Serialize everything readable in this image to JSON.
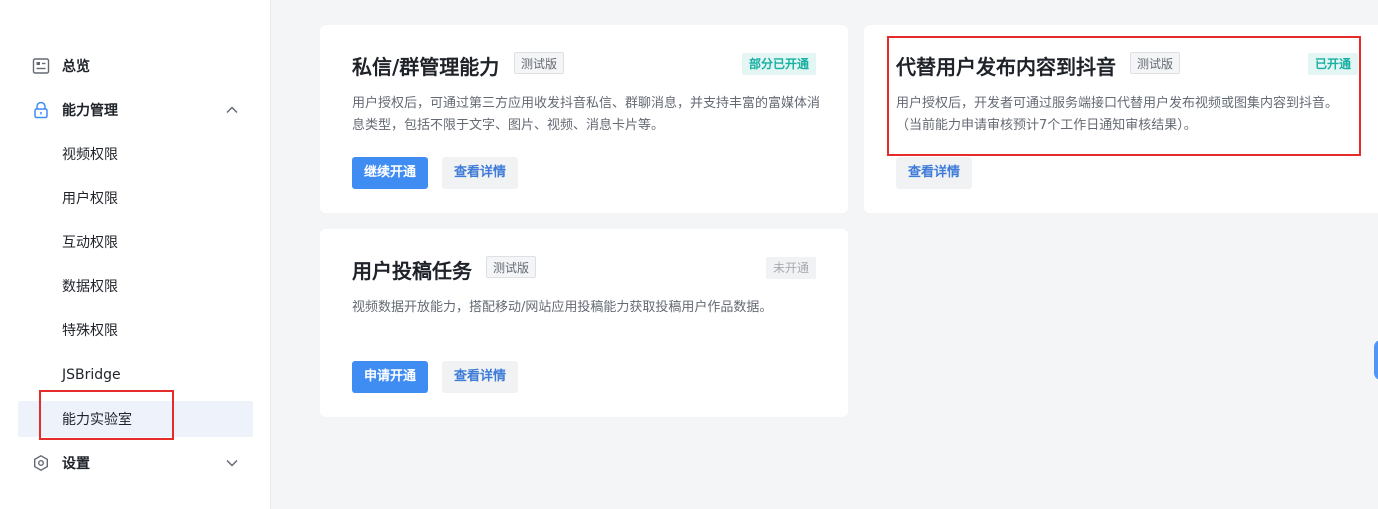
{
  "sidebar": {
    "items": [
      {
        "label": "总览",
        "icon": "overview-icon"
      },
      {
        "label": "能力管理",
        "icon": "lock-icon"
      },
      {
        "label": "视频权限"
      },
      {
        "label": "用户权限"
      },
      {
        "label": "互动权限"
      },
      {
        "label": "数据权限"
      },
      {
        "label": "特殊权限"
      },
      {
        "label": "JSBridge"
      },
      {
        "label": "能力实验室"
      },
      {
        "label": "设置",
        "icon": "settings-icon"
      }
    ]
  },
  "cards": [
    {
      "title": "私信/群管理能力",
      "beta_tag": "测试版",
      "status": "部分已开通",
      "description": "用户授权后，可通过第三方应用收发抖音私信、群聊消息，并支持丰富的富媒体消息类型，包括不限于文字、图片、视频、消息卡片等。",
      "primary_button": "继续开通",
      "detail_button": "查看详情"
    },
    {
      "title": "代替用户发布内容到抖音",
      "beta_tag": "测试版",
      "status": "已开通",
      "description": "用户授权后，开发者可通过服务端接口代替用户发布视频或图集内容到抖音。（当前能力申请审核预计7个工作日通知审核结果）。",
      "detail_button": "查看详情"
    },
    {
      "title": "用户投稿任务",
      "beta_tag": "测试版",
      "status": "未开通",
      "description": "视频数据开放能力，搭配移动/网站应用投稿能力获取投稿用户作品数据。",
      "primary_button": "申请开通",
      "detail_button": "查看详情"
    }
  ],
  "colors": {
    "primary": "#3f8cf3",
    "status_enabled": "#18b0a2",
    "highlight": "#e62b2b"
  }
}
